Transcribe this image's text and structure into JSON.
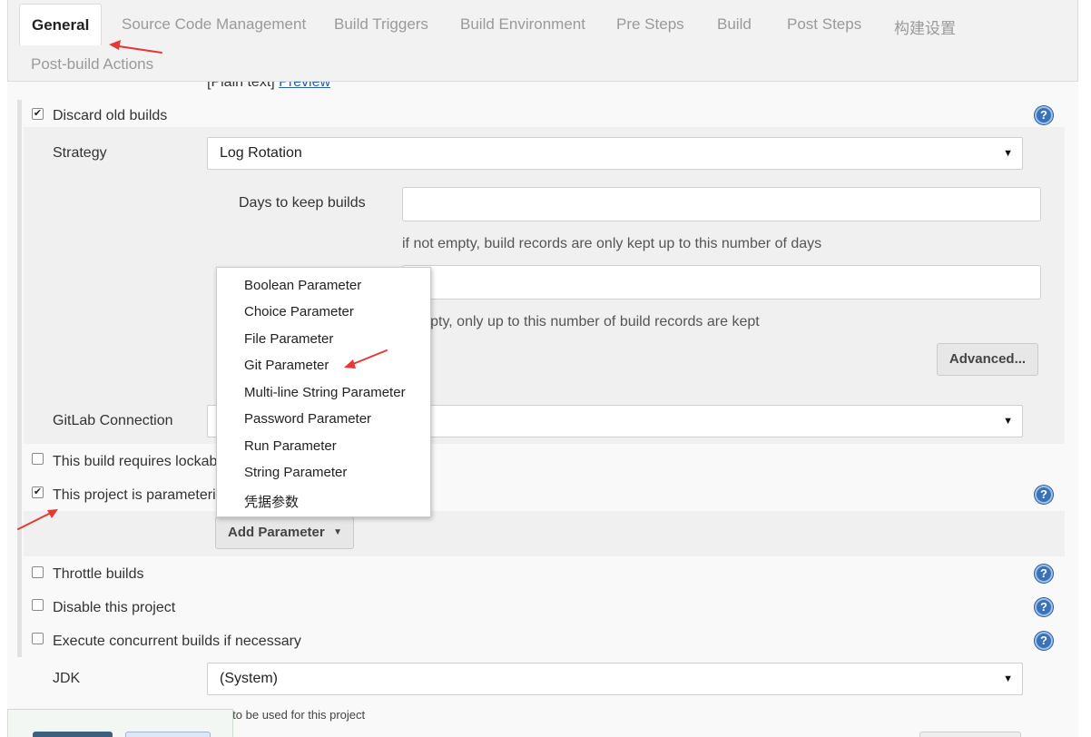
{
  "tabs": [
    {
      "label": "General",
      "active": true
    },
    {
      "label": "Source Code Management"
    },
    {
      "label": "Build Triggers"
    },
    {
      "label": "Build Environment"
    },
    {
      "label": "Pre Steps"
    },
    {
      "label": "Build"
    },
    {
      "label": "Post Steps"
    },
    {
      "label": "构建设置"
    },
    {
      "label": "Post-build Actions"
    }
  ],
  "description": {
    "plain_text": "[Plain text]",
    "preview_link": "Preview"
  },
  "discard_old_builds": {
    "label": "Discard old builds",
    "checked": true,
    "strategy_label": "Strategy",
    "strategy_value": "Log Rotation",
    "days_label": "Days to keep builds",
    "days_value": "",
    "days_hint": "if not empty, build records are only kept up to this number of days",
    "max_value": "",
    "max_hint_visible": "t empty, only up to this number of build records are kept",
    "advanced_button": "Advanced..."
  },
  "gitlab": {
    "label": "GitLab Connection",
    "value": ""
  },
  "options": {
    "lockable": {
      "label": "This build requires lockab",
      "checked": false
    },
    "parameterized": {
      "label": "This project is parameteri",
      "checked": true
    },
    "throttle": {
      "label": "Throttle builds",
      "checked": false
    },
    "disable": {
      "label": "Disable this project",
      "checked": false
    },
    "concurrent": {
      "label": "Execute concurrent builds if necessary",
      "checked": false
    }
  },
  "add_parameter_button": "Add Parameter",
  "parameter_menu": [
    "Boolean Parameter",
    "Choice Parameter",
    "File Parameter",
    "Git Parameter",
    "Multi-line String Parameter",
    "Password Parameter",
    "Run Parameter",
    "String Parameter",
    "凭据参数"
  ],
  "jdk": {
    "label": "JDK",
    "value": "(System)",
    "hint": "JDK to be used for this project"
  },
  "icons": {
    "help": "?",
    "checkmark": "✔",
    "caret": "▼"
  },
  "colors": {
    "annotation_arrow": "#e53935",
    "help_icon": "#3a72b8",
    "link": "#2b5fa8"
  }
}
